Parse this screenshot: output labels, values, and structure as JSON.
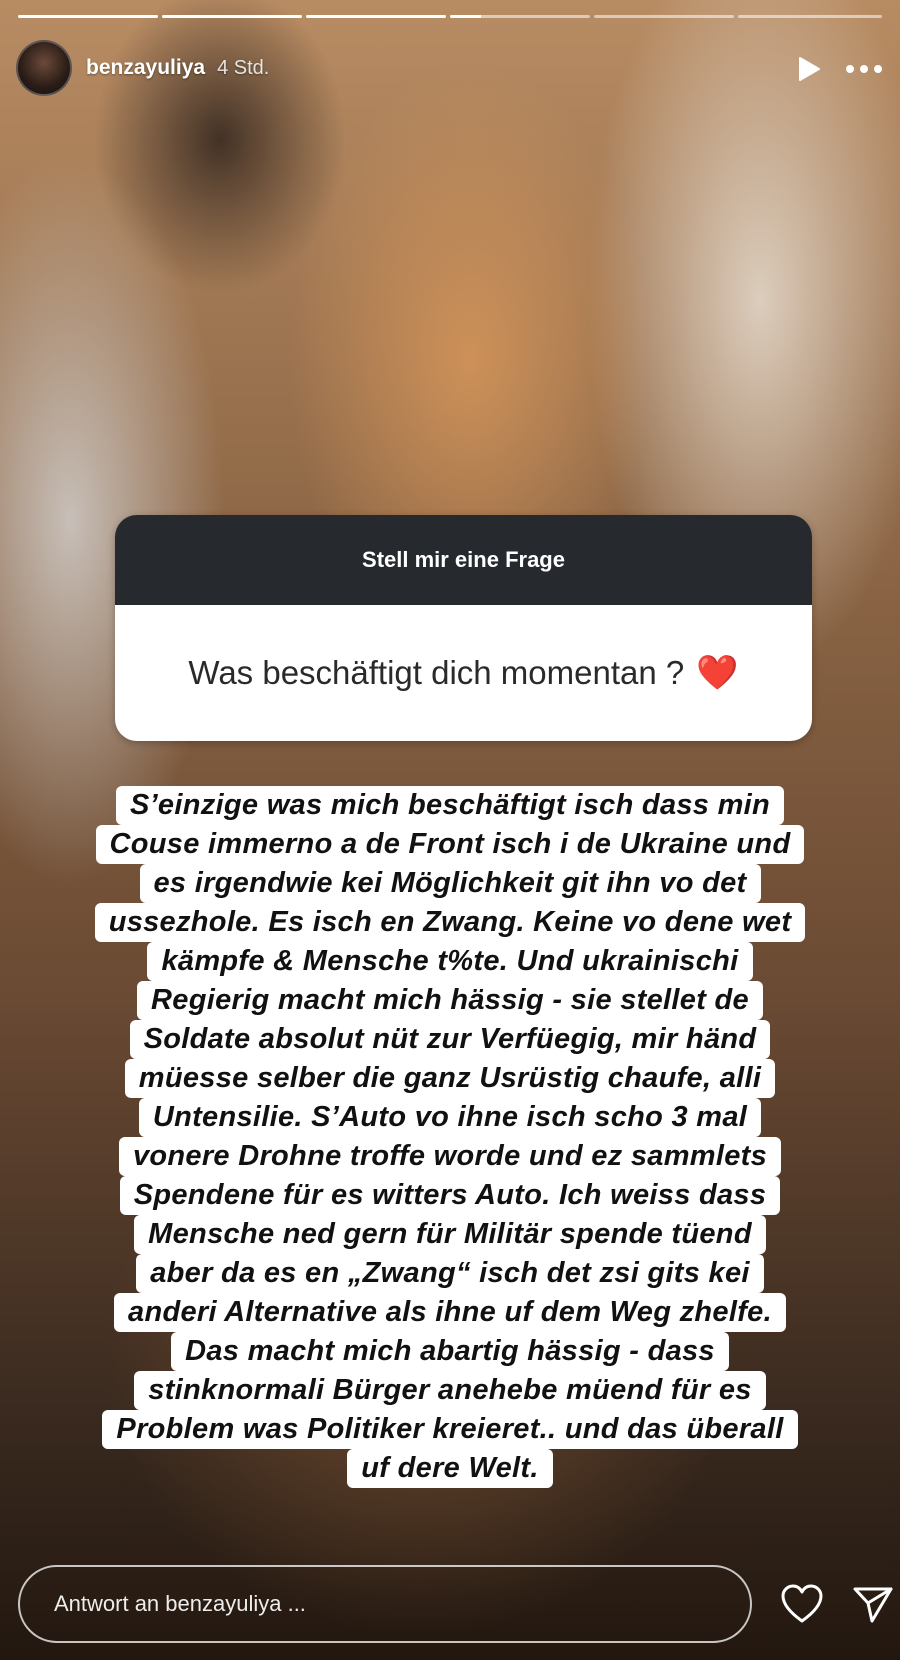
{
  "story": {
    "progress_segments": [
      {
        "state": "done"
      },
      {
        "state": "done"
      },
      {
        "state": "done"
      },
      {
        "state": "active"
      },
      {
        "state": "pending"
      },
      {
        "state": "pending"
      }
    ]
  },
  "header": {
    "username": "benzayuliya",
    "time": "4 Std.",
    "play_icon": "play-icon",
    "more_icon": "more-icon"
  },
  "question_sticker": {
    "title": "Stell mir eine Frage",
    "question": "Was beschäftigt dich momentan ?",
    "emoji": "❤️"
  },
  "answer": {
    "lines": [
      "S’einzige was mich beschäftigt isch dass min",
      "Couse immerno a de Front isch i de Ukraine und",
      "es irgendwie kei Möglichkeit git ihn vo det",
      "ussezhole. Es isch en Zwang. Keine vo dene wet",
      "kämpfe & Mensche t%te. Und ukrainischi",
      "Regierig macht mich hässig - sie stellet de",
      "Soldate absolut nüt zur Verfüegig, mir händ",
      "müesse selber die ganz Usrüstig chaufe, alli",
      "Untensilie. S’Auto vo ihne isch scho 3 mal",
      "vonere Drohne troffe worde und ez sammlets",
      "Spendene für es witters Auto. Ich weiss dass",
      "Mensche ned gern für Militär spende tüend",
      "aber da es en „Zwang“ isch det zsi gits kei",
      "anderi Alternative als ihne uf dem Weg zhelfe.",
      "Das macht mich abartig hässig - dass",
      "stinknormali Bürger anehebe müend für es",
      "Problem was Politiker kreieret.. und das überall",
      "uf dere Welt."
    ]
  },
  "footer": {
    "reply_placeholder": "Antwort an benzayuliya ...",
    "like_icon": "heart-icon",
    "send_icon": "send-icon"
  },
  "colors": {
    "sticker_header": "#26292e",
    "sticker_body": "#ffffff",
    "heart": "#e0202a"
  }
}
